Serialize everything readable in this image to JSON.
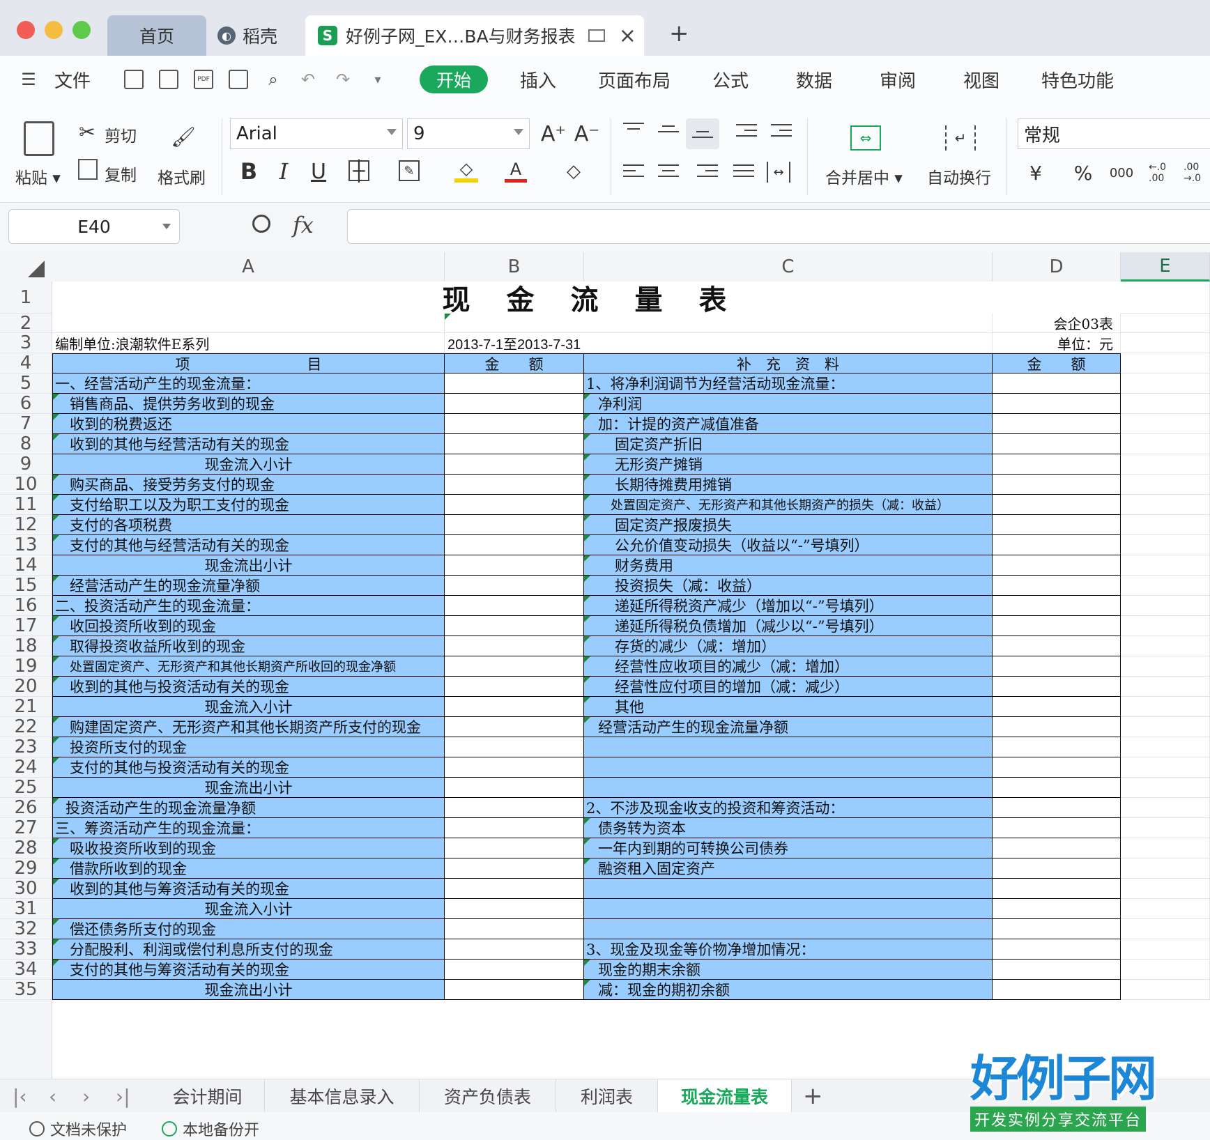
{
  "window": {
    "tabs": [
      {
        "label": "首页"
      },
      {
        "label": "稻壳"
      },
      {
        "label": "好例子网_EX…BA与财务报表"
      }
    ]
  },
  "menu": {
    "file": "文件",
    "items": [
      "开始",
      "插入",
      "页面布局",
      "公式",
      "数据",
      "审阅",
      "视图",
      "特色功能"
    ]
  },
  "ribbon": {
    "paste": "粘贴",
    "cut": "剪切",
    "copy": "复制",
    "format_painter": "格式刷",
    "font_name": "Arial",
    "font_size": "9",
    "merge_center": "合并居中",
    "wrap_text": "自动换行",
    "number_format": "常规",
    "bold": "B",
    "italic": "I",
    "underline": "U",
    "currency": "¥",
    "percent": "%",
    "thousands": "000",
    "inc_decimal": "←.0 .00",
    "dec_decimal": ".00 →.0"
  },
  "formula_bar": {
    "cell_ref": "E40",
    "fx": "fx",
    "formula": ""
  },
  "columns": [
    "A",
    "B",
    "C",
    "D",
    "E"
  ],
  "rows": [
    "1",
    "2",
    "3",
    "4",
    "5",
    "6",
    "7",
    "8",
    "9",
    "10",
    "11",
    "12",
    "13",
    "14",
    "15",
    "16",
    "17",
    "18",
    "19",
    "20",
    "21",
    "22",
    "23",
    "24",
    "25",
    "26",
    "27",
    "28",
    "29",
    "30",
    "31",
    "32",
    "33",
    "34",
    "35"
  ],
  "sheet": {
    "title": "现　金　流　量　表",
    "form_no": "会企03表",
    "org": "编制单位:浪潮软件E系列",
    "period": "2013-7-1至2013-7-31",
    "unit": "单位：元",
    "headers": {
      "item": "项　　　　　　　　目",
      "amount": "金　　额",
      "supplement": "补　充　资　料",
      "amount2": "金　　额"
    },
    "left": [
      "一、经营活动产生的现金流量：",
      "销售商品、提供劳务收到的现金",
      "收到的税费返还",
      "收到的其他与经营活动有关的现金",
      "现金流入小计",
      "购买商品、接受劳务支付的现金",
      "支付给职工以及为职工支付的现金",
      "支付的各项税费",
      "支付的其他与经营活动有关的现金",
      "现金流出小计",
      "经营活动产生的现金流量净额",
      "二、投资活动产生的现金流量：",
      "收回投资所收到的现金",
      "取得投资收益所收到的现金",
      "处置固定资产、无形资产和其他长期资产所收回的现金净额",
      "收到的其他与投资活动有关的现金",
      "现金流入小计",
      "购建固定资产、无形资产和其他长期资产所支付的现金",
      "投资所支付的现金",
      "支付的其他与投资活动有关的现金",
      "现金流出小计",
      "投资活动产生的现金流量净额",
      "三、筹资活动产生的现金流量：",
      "吸收投资所收到的现金",
      "借款所收到的现金",
      "收到的其他与筹资活动有关的现金",
      "现金流入小计",
      "偿还债务所支付的现金",
      "分配股利、利润或偿付利息所支付的现金",
      "支付的其他与筹资活动有关的现金",
      "现金流出小计"
    ],
    "right": [
      "1、将净利润调节为经营活动现金流量：",
      "净利润",
      "加：计提的资产减值准备",
      "固定资产折旧",
      "无形资产摊销",
      "长期待摊费用摊销",
      "处置固定资产、无形资产和其他长期资产的损失（减：收益）",
      "固定资产报废损失",
      "公允价值变动损失（收益以“-”号填列）",
      "财务费用",
      "投资损失（减：收益）",
      "递延所得税资产减少（增加以“-”号填列）",
      "递延所得税负债增加（减少以“-”号填列）",
      "存货的减少（减：增加）",
      "经营性应收项目的减少（减：增加）",
      "经营性应付项目的增加（减：减少）",
      "其他",
      "经营活动产生的现金流量净额",
      "",
      "",
      "",
      "2、不涉及现金收支的投资和筹资活动：",
      "债务转为资本",
      "一年内到期的可转换公司债券",
      "融资租入固定资产",
      "",
      "",
      "",
      "3、现金及现金等价物净增加情况：",
      "现金的期末余额",
      "减：现金的期初余额"
    ]
  },
  "sheet_tabs": [
    "会计期间",
    "基本信息录入",
    "资产负债表",
    "利润表",
    "现金流量表"
  ],
  "active_sheet": "现金流量表",
  "status": {
    "protect": "文档未保护",
    "backup": "本地备份开"
  },
  "brand": {
    "title": "好例子网",
    "subtitle": "开发实例分享交流平台"
  }
}
